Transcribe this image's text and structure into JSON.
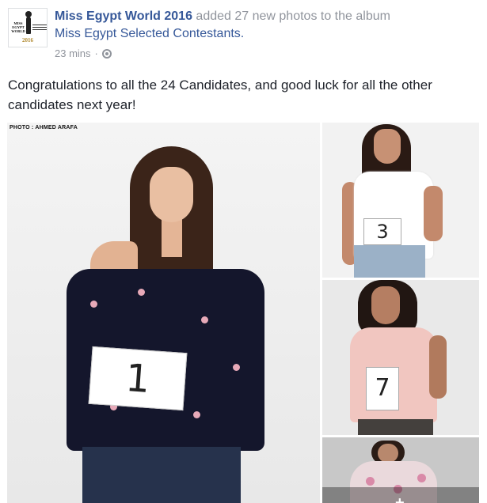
{
  "post": {
    "author": "Miss Egypt World 2016",
    "action": " added 27 new photos to the album",
    "album": "Miss Egypt Selected Contestants.",
    "timestamp": "23 mins",
    "separator": "·",
    "privacy_icon": "globe-icon",
    "message": "Congratulations to all the 24 Candidates, and good luck for all the other candidates next year!"
  },
  "avatar": {
    "logo_left": "MISS EGYPT WORLD",
    "logo_year": "2016"
  },
  "photos": {
    "credit": "PHOTO : AHMED ARAFA",
    "card_numbers": [
      "1",
      "3",
      "7"
    ],
    "more_overlay": "+"
  },
  "colors": {
    "link": "#365899",
    "meta": "#90949c",
    "text": "#1d2129"
  }
}
